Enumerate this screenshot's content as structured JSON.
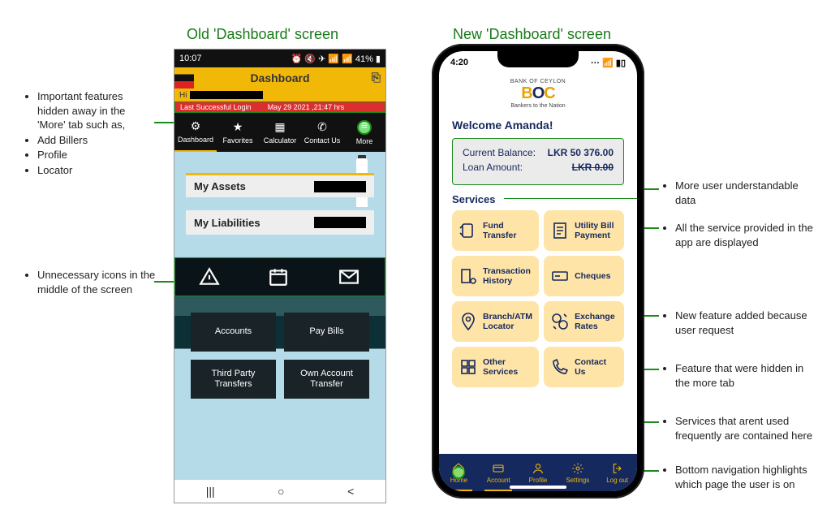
{
  "titles": {
    "old": "Old 'Dashboard' screen",
    "new": "New 'Dashboard' screen"
  },
  "annotations": {
    "a": {
      "lead": "Important features hidden away in the 'More' tab such as,",
      "items": [
        "Add Billers",
        "Profile",
        "Locator"
      ]
    },
    "b": "Unnecessary icons in the middle of the screen",
    "c": "More user understandable data",
    "d": "All the service provided in the app are displayed",
    "e": "New feature added because user request",
    "f": "Feature that were hidden in the more tab",
    "g": "Services that arent used frequently are contained here",
    "h": "Bottom navigation highlights which page the user is on"
  },
  "old": {
    "status": {
      "time": "10:07",
      "icons_text": "⏰ 🔇 ✈ 📶 📶 41% ▮"
    },
    "header": "Dashboard",
    "hi": "Hi",
    "login_line": {
      "label": "Last Successful Login",
      "stamp": "May 29 2021 ,21:47 hrs"
    },
    "nav": [
      "Dashboard",
      "Favorites",
      "Calculator",
      "Contact Us",
      "More"
    ],
    "rows": [
      "My Assets",
      "My Liabilities"
    ],
    "btns": [
      "Accounts",
      "Pay Bills",
      "Third Party Transfers",
      "Own Account Transfer"
    ],
    "sys": [
      "|||",
      "○",
      "<"
    ]
  },
  "new": {
    "status": {
      "time": "4:20",
      "r": "···  📶  ▮▯"
    },
    "logo": {
      "top": "BANK OF CEYLON",
      "main_b": "B",
      "main_o": "O",
      "main_c": "C",
      "sub": "Bankers to the Nation"
    },
    "welcome": "Welcome Amanda!",
    "balance": {
      "rows": [
        {
          "label": "Current Balance:",
          "value": "LKR 50 376.00"
        },
        {
          "label": "Loan Amount:",
          "value": "LKR 0.00"
        }
      ]
    },
    "services_heading": "Services",
    "services": [
      "Fund Transfer",
      "Utility Bill Payment",
      "Transaction History",
      "Cheques",
      "Branch/ATM Locator",
      "Exchange Rates",
      "Other Services",
      "Contact Us"
    ],
    "bottom_nav": [
      "Home",
      "Account",
      "Profile",
      "Settings",
      "Log out"
    ]
  }
}
